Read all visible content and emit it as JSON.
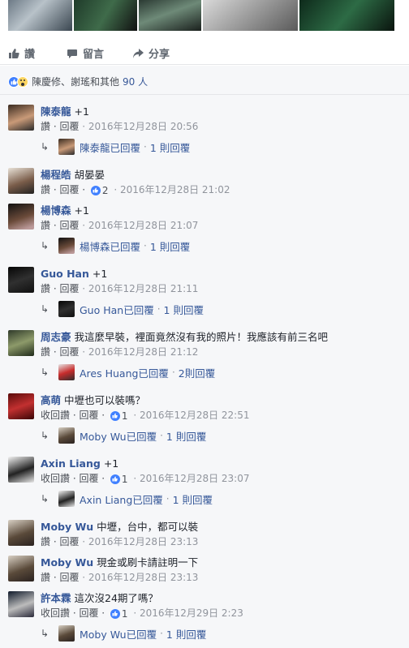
{
  "actions": {
    "like": "讚",
    "comment": "留言",
    "share": "分享"
  },
  "reactions": {
    "text": "陳慶修、謝瑤和其他",
    "count": "90 人"
  },
  "comments": [
    {
      "author": "陳泰龍",
      "text": "+1",
      "actions": "讚 · 回覆",
      "likes": "",
      "time": "2016年12月28日 20:56",
      "reply": {
        "name": "陳泰龍已回覆",
        "count": "1 則回覆"
      }
    },
    {
      "author": "楊程皓",
      "text": "胡晏晏",
      "actions": "讚 · 回覆 ·",
      "likes": "2",
      "time": "2016年12月28日 21:02"
    },
    {
      "author": "楊博森",
      "text": "+1",
      "actions": "讚 · 回覆",
      "likes": "",
      "time": "2016年12月28日 21:07",
      "reply": {
        "name": "楊博森已回覆",
        "count": "1 則回覆"
      }
    },
    {
      "author": "Guo Han",
      "text": "+1",
      "actions": "讚 · 回覆",
      "likes": "",
      "time": "2016年12月28日 21:11",
      "reply": {
        "name": "Guo Han已回覆",
        "count": "1 則回覆"
      }
    },
    {
      "author": "周志豪",
      "text": "我這麼早裝，裡面竟然沒有我的照片！我應該有前三名吧",
      "actions": "讚 · 回覆",
      "likes": "",
      "time": "2016年12月28日 21:12",
      "reply": {
        "name": "Ares Huang已回覆",
        "count": "2則回覆"
      }
    },
    {
      "author": "高萌",
      "text": "中壢也可以裝嗎？",
      "actions": "收回讚 · 回覆 ·",
      "likes": "1",
      "time": "2016年12月28日 22:51",
      "reply": {
        "name": "Moby Wu已回覆",
        "count": "1 則回覆"
      }
    },
    {
      "author": "Axin Liang",
      "text": "+1",
      "actions": "收回讚 · 回覆 ·",
      "likes": "1",
      "time": "2016年12月28日 23:07",
      "reply": {
        "name": "Axin Liang已回覆",
        "count": "1 則回覆"
      }
    },
    {
      "author": "Moby Wu",
      "text": "中壢，台中，都可以裝",
      "actions": "讚 · 回覆",
      "likes": "",
      "time": "2016年12月28日 23:13"
    },
    {
      "author": "Moby Wu",
      "text": "現金或刷卡請註明一下",
      "actions": "讚 · 回覆",
      "likes": "",
      "time": "2016年12月28日 23:13"
    },
    {
      "author": "許本霖",
      "text": "這次沒24期了嗎？",
      "actions": "收回讚 · 回覆 ·",
      "likes": "1",
      "time": "2016年12月29日 2:23",
      "reply": {
        "name": "Moby Wu已回覆",
        "count": "1 則回覆"
      }
    }
  ],
  "colors": {
    "link": "#365899",
    "like_blue": "#4080ff",
    "meta": "#90949c",
    "bg": "#f6f7f9"
  }
}
